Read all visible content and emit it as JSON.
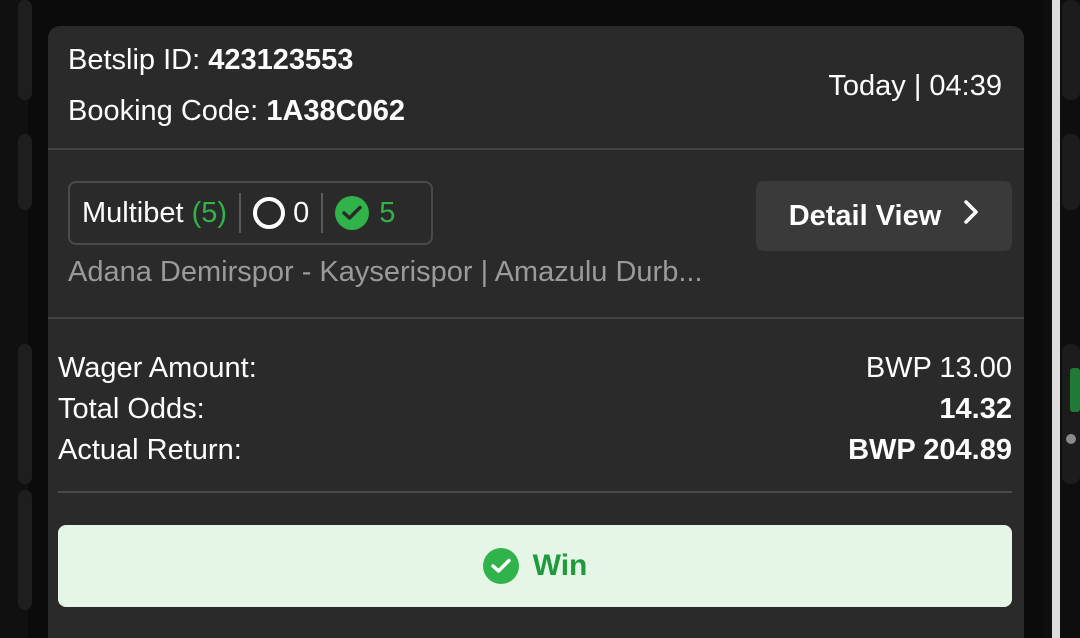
{
  "betslip": {
    "id_label": "Betslip ID:",
    "id_value": "423123553",
    "booking_label": "Booking Code:",
    "booking_value": "1A38C062",
    "time": "Today | 04:39"
  },
  "summary": {
    "bet_type": "Multibet",
    "selection_count": "(5)",
    "pending_count": "0",
    "won_count": "5",
    "matches": "Adana Demirspor - Kayserispor | Amazulu Durb...",
    "detail_button": "Detail View"
  },
  "amounts": {
    "wager_label": "Wager Amount:",
    "wager_value": "BWP 13.00",
    "odds_label": "Total Odds:",
    "odds_value": "14.32",
    "return_label": "Actual Return:",
    "return_value": "BWP 204.89"
  },
  "result": {
    "label": "Win"
  },
  "icons": {
    "pending": "circle-outline-icon",
    "won": "check-circle-icon",
    "detail": "chevron-right-icon"
  },
  "colors": {
    "background": "#0b0b0b",
    "card": "#2a2a2a",
    "accent_green": "#2fb34a",
    "win_background": "#e5f6e7",
    "muted_text": "#9a9a9a"
  }
}
